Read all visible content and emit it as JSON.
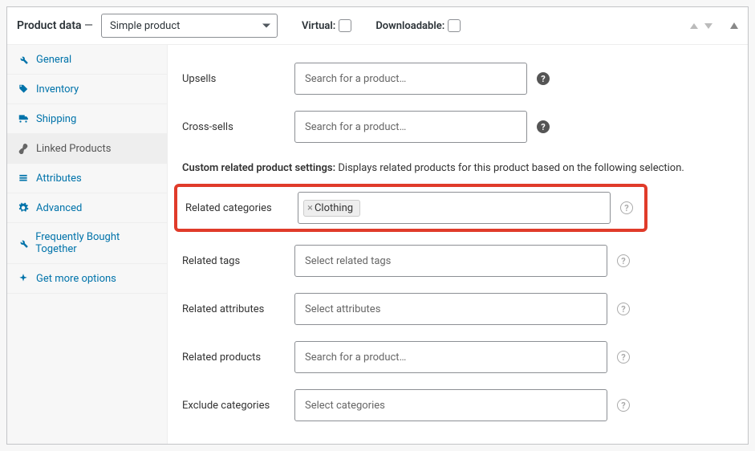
{
  "header": {
    "title": "Product data",
    "dash": " — ",
    "product_type": "Simple product",
    "virtual_label": "Virtual:",
    "downloadable_label": "Downloadable:"
  },
  "sidebar": {
    "items": [
      {
        "label": "General"
      },
      {
        "label": "Inventory"
      },
      {
        "label": "Shipping"
      },
      {
        "label": "Linked Products"
      },
      {
        "label": "Attributes"
      },
      {
        "label": "Advanced"
      },
      {
        "label": "Frequently Bought Together"
      },
      {
        "label": "Get more options"
      }
    ]
  },
  "content": {
    "upsells": {
      "label": "Upsells",
      "placeholder": "Search for a product…"
    },
    "crosssells": {
      "label": "Cross-sells",
      "placeholder": "Search for a product…"
    },
    "custom_heading_bold": "Custom related product settings:",
    "custom_heading_rest": " Displays related products for this product based on the following selection.",
    "related_categories": {
      "label": "Related categories",
      "tag": "Clothing"
    },
    "related_tags": {
      "label": "Related tags",
      "placeholder": "Select related tags"
    },
    "related_attributes": {
      "label": "Related attributes",
      "placeholder": "Select attributes"
    },
    "related_products": {
      "label": "Related products",
      "placeholder": "Search for a product…"
    },
    "exclude_categories": {
      "label": "Exclude categories",
      "placeholder": "Select categories"
    }
  }
}
